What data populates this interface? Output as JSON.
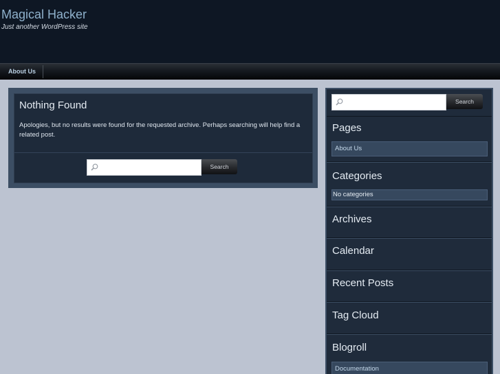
{
  "site": {
    "title": "Magical Hacker",
    "description": "Just another WordPress site"
  },
  "nav": {
    "items": [
      {
        "label": "About Us"
      }
    ]
  },
  "main": {
    "title": "Nothing Found",
    "message": "Apologies, but no results were found for the requested archive. Perhaps searching will help find a related post.",
    "search": {
      "value": "",
      "button_label": "Search"
    }
  },
  "sidebar": {
    "search": {
      "value": "",
      "button_label": "Search"
    },
    "pages": {
      "title": "Pages",
      "items": [
        {
          "label": "About Us"
        }
      ]
    },
    "categories": {
      "title": "Categories",
      "empty_text": "No categories"
    },
    "archives": {
      "title": "Archives"
    },
    "calendar": {
      "title": "Calendar"
    },
    "recent_posts": {
      "title": "Recent Posts"
    },
    "tag_cloud": {
      "title": "Tag Cloud"
    },
    "blogroll": {
      "title": "Blogroll",
      "items": [
        {
          "label": "Documentation"
        }
      ]
    }
  },
  "icons": {
    "search": "search-icon"
  },
  "colors": {
    "header_bg": "#0e1724",
    "page_bg": "#bcc3d1",
    "panel_bg": "#1f2b3b",
    "panel_border": "#3c4e64",
    "title_link": "#8fb1cc"
  }
}
